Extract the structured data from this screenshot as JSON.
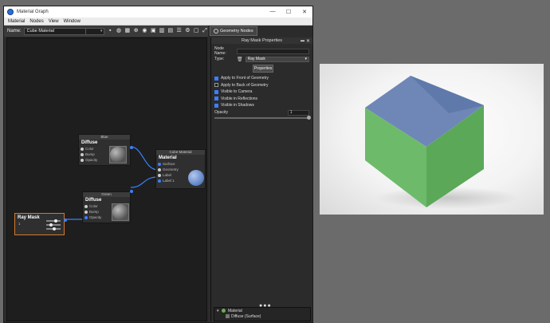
{
  "window": {
    "title": "Material Graph",
    "controls": {
      "minimize": "—",
      "maximize": "☐",
      "close": "✕"
    }
  },
  "menu": [
    "Material",
    "Nodes",
    "View",
    "Window"
  ],
  "toolbar": {
    "name_label": "Name:",
    "name_value": "Cube Material",
    "geometry_nodes_label": "Geometry Nodes"
  },
  "nodes": {
    "blue": {
      "header": "Blue",
      "title": "Diffuse",
      "ports": [
        "Color",
        "Bump",
        "Opacity"
      ]
    },
    "green": {
      "header": "Green",
      "title": "Diffuse",
      "ports": [
        "Color",
        "Bump",
        "Opacity"
      ]
    },
    "cube_material": {
      "header": "Cube Material",
      "title": "Material",
      "ports": [
        "Surface",
        "Geometry",
        "Label",
        "Label 1"
      ]
    },
    "ray_mask": {
      "title": "Ray Mask",
      "port": "1"
    }
  },
  "properties": {
    "panel_title": "Ray Mask Properties",
    "node_name_label": "Node Name:",
    "node_name_value": "",
    "type_label": "Type:",
    "type_value": "Ray Mask",
    "properties_button": "Properties",
    "checkboxes": [
      {
        "label": "Apply to Front of Geometry",
        "checked": true
      },
      {
        "label": "Apply to Back of Geometry",
        "checked": false
      },
      {
        "label": "Visible to Camera",
        "checked": true
      },
      {
        "label": "Visible in Reflections",
        "checked": true
      },
      {
        "label": "Visible in Shadows",
        "checked": true
      }
    ],
    "opacity_label": "Opacity",
    "opacity_value": "1"
  },
  "tree": {
    "material": "Material",
    "child": "Diffuse (Surface)"
  },
  "colors": {
    "accent": "#3b7fff",
    "cube_green": "#6dbb6a",
    "cube_inner_blue": "#6d85b4"
  }
}
